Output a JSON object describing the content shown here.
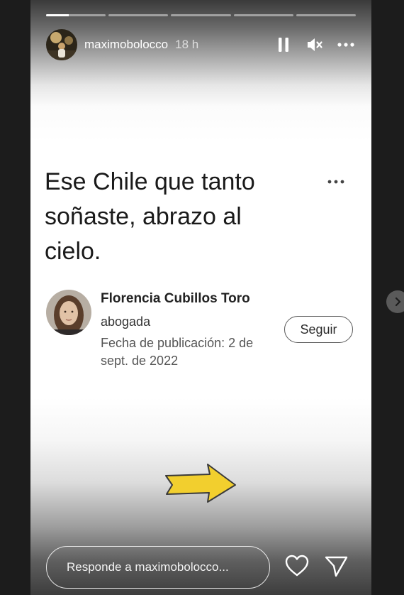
{
  "story": {
    "progress_segments": [
      {
        "progress": 0.38
      },
      {
        "progress": 0
      },
      {
        "progress": 0
      },
      {
        "progress": 0
      },
      {
        "progress": 0
      }
    ],
    "username": "maximobolocco",
    "time_ago": "18 h",
    "icons": {
      "pause": "pause-icon",
      "mute": "mute-icon",
      "more": "more-icon",
      "like": "heart-icon",
      "share": "send-icon",
      "next": "chevron-right-icon"
    }
  },
  "post": {
    "text": "Ese Chile que tanto soñaste, abrazo al cielo.",
    "author": {
      "name": "Florencia Cubillos Toro",
      "role": "abogada",
      "published": "Fecha de publicación: 2 de sept. de 2022"
    },
    "follow_label": "Seguir"
  },
  "reply": {
    "placeholder": "Responde a maximobolocco..."
  },
  "colors": {
    "arrow_fill": "#f2cf2e",
    "arrow_stroke": "#3a3a3a"
  }
}
